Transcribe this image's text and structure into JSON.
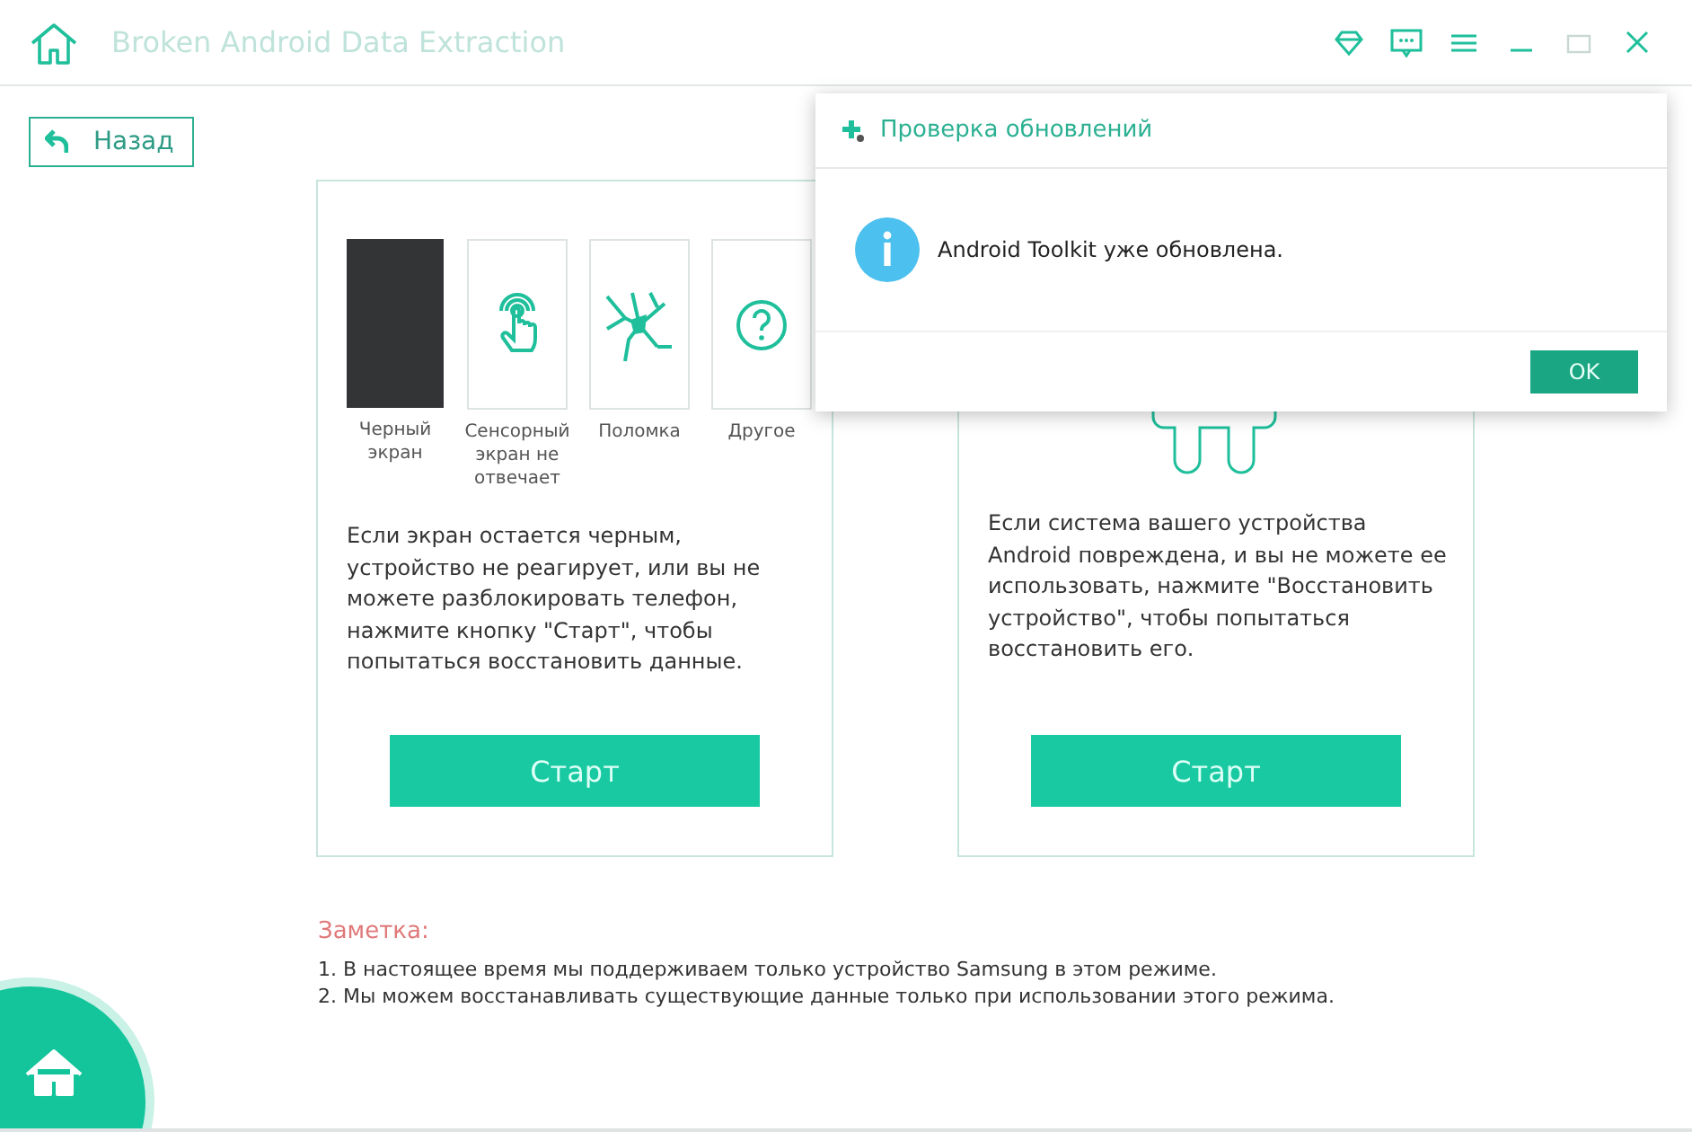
{
  "window": {
    "title": "Broken Android Data Extraction"
  },
  "back_button": {
    "label": "Назад"
  },
  "cards": [
    {
      "kind": "broken-screen",
      "issues": [
        {
          "kind": "black-screen",
          "label": "Черный экран"
        },
        {
          "kind": "touch",
          "label": "Сенсорный экран не отвечает"
        },
        {
          "kind": "broken",
          "label": "Поломка"
        },
        {
          "kind": "other",
          "label": "Другое"
        }
      ],
      "description": "Если экран остается черным, устройство не реагирует, или вы не можете разблокировать телефон, нажмите кнопку \"Старт\", чтобы попытаться восстановить данные.",
      "button": "Старт"
    },
    {
      "kind": "system",
      "description": "Если система вашего устройства Android повреждена, и вы не можете ее использовать, нажмите \"Восстановить устройство\", чтобы попытаться восстановить его.",
      "button": "Старт"
    }
  ],
  "note": {
    "title": "Заметка:",
    "items": [
      "1. В настоящее время мы поддерживаем только устройство Samsung в этом режиме.",
      "2. Мы можем восстанавливать существующие данные только при использовании этого режима."
    ]
  },
  "dialog": {
    "title": "Проверка обновлений",
    "message": "Android Toolkit уже обновлена.",
    "button": "OK"
  }
}
